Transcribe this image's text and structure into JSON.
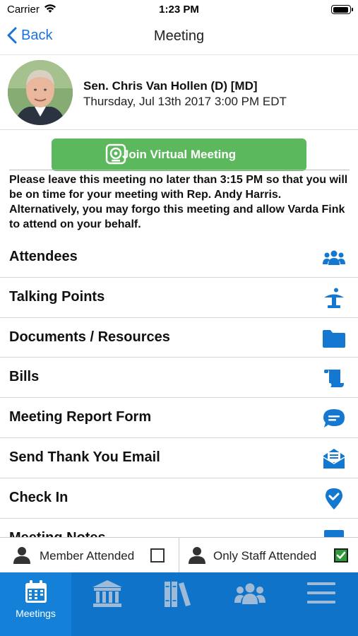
{
  "status_bar": {
    "carrier": "Carrier",
    "time": "1:23 PM"
  },
  "nav": {
    "back_label": "Back",
    "title": "Meeting"
  },
  "header": {
    "member_name": "Sen. Chris Van Hollen (D) [MD]",
    "datetime": "Thursday, Jul 13th 2017 3:00 PM EDT"
  },
  "join_button": {
    "label": "Join Virtual Meeting"
  },
  "notice": "Please leave this meeting no later than 3:15 PM so that you will be on time for your meeting with Rep. Andy Harris. Alternatively, you may forgo this meeting and allow Varda Fink to attend on your behalf.",
  "menu": {
    "items": [
      {
        "label": "Attendees",
        "icon": "people-icon"
      },
      {
        "label": "Talking Points",
        "icon": "podium-icon"
      },
      {
        "label": "Documents / Resources",
        "icon": "folder-icon"
      },
      {
        "label": "Bills",
        "icon": "scroll-icon"
      },
      {
        "label": "Meeting Report Form",
        "icon": "chat-icon"
      },
      {
        "label": "Send Thank You Email",
        "icon": "envelope-icon"
      },
      {
        "label": "Check In",
        "icon": "map-pin-check-icon"
      },
      {
        "label": "Meeting Notes",
        "icon": "notes-icon"
      }
    ]
  },
  "attendance": {
    "member_label": "Member Attended",
    "member_checked": false,
    "staff_label": "Only Staff Attended",
    "staff_checked": true
  },
  "tabbar": {
    "tabs": [
      {
        "label": "Meetings",
        "icon": "calendar-icon",
        "active": true
      },
      {
        "label": "",
        "icon": "capitol-icon",
        "active": false
      },
      {
        "label": "",
        "icon": "books-icon",
        "active": false
      },
      {
        "label": "",
        "icon": "people-icon",
        "active": false
      },
      {
        "label": "",
        "icon": "menu-icon",
        "active": false
      }
    ]
  },
  "colors": {
    "accent": "#0f74c9",
    "join_green": "#5cb85c",
    "icon_blue": "#1478d0",
    "check_green": "#2e9a3a"
  }
}
